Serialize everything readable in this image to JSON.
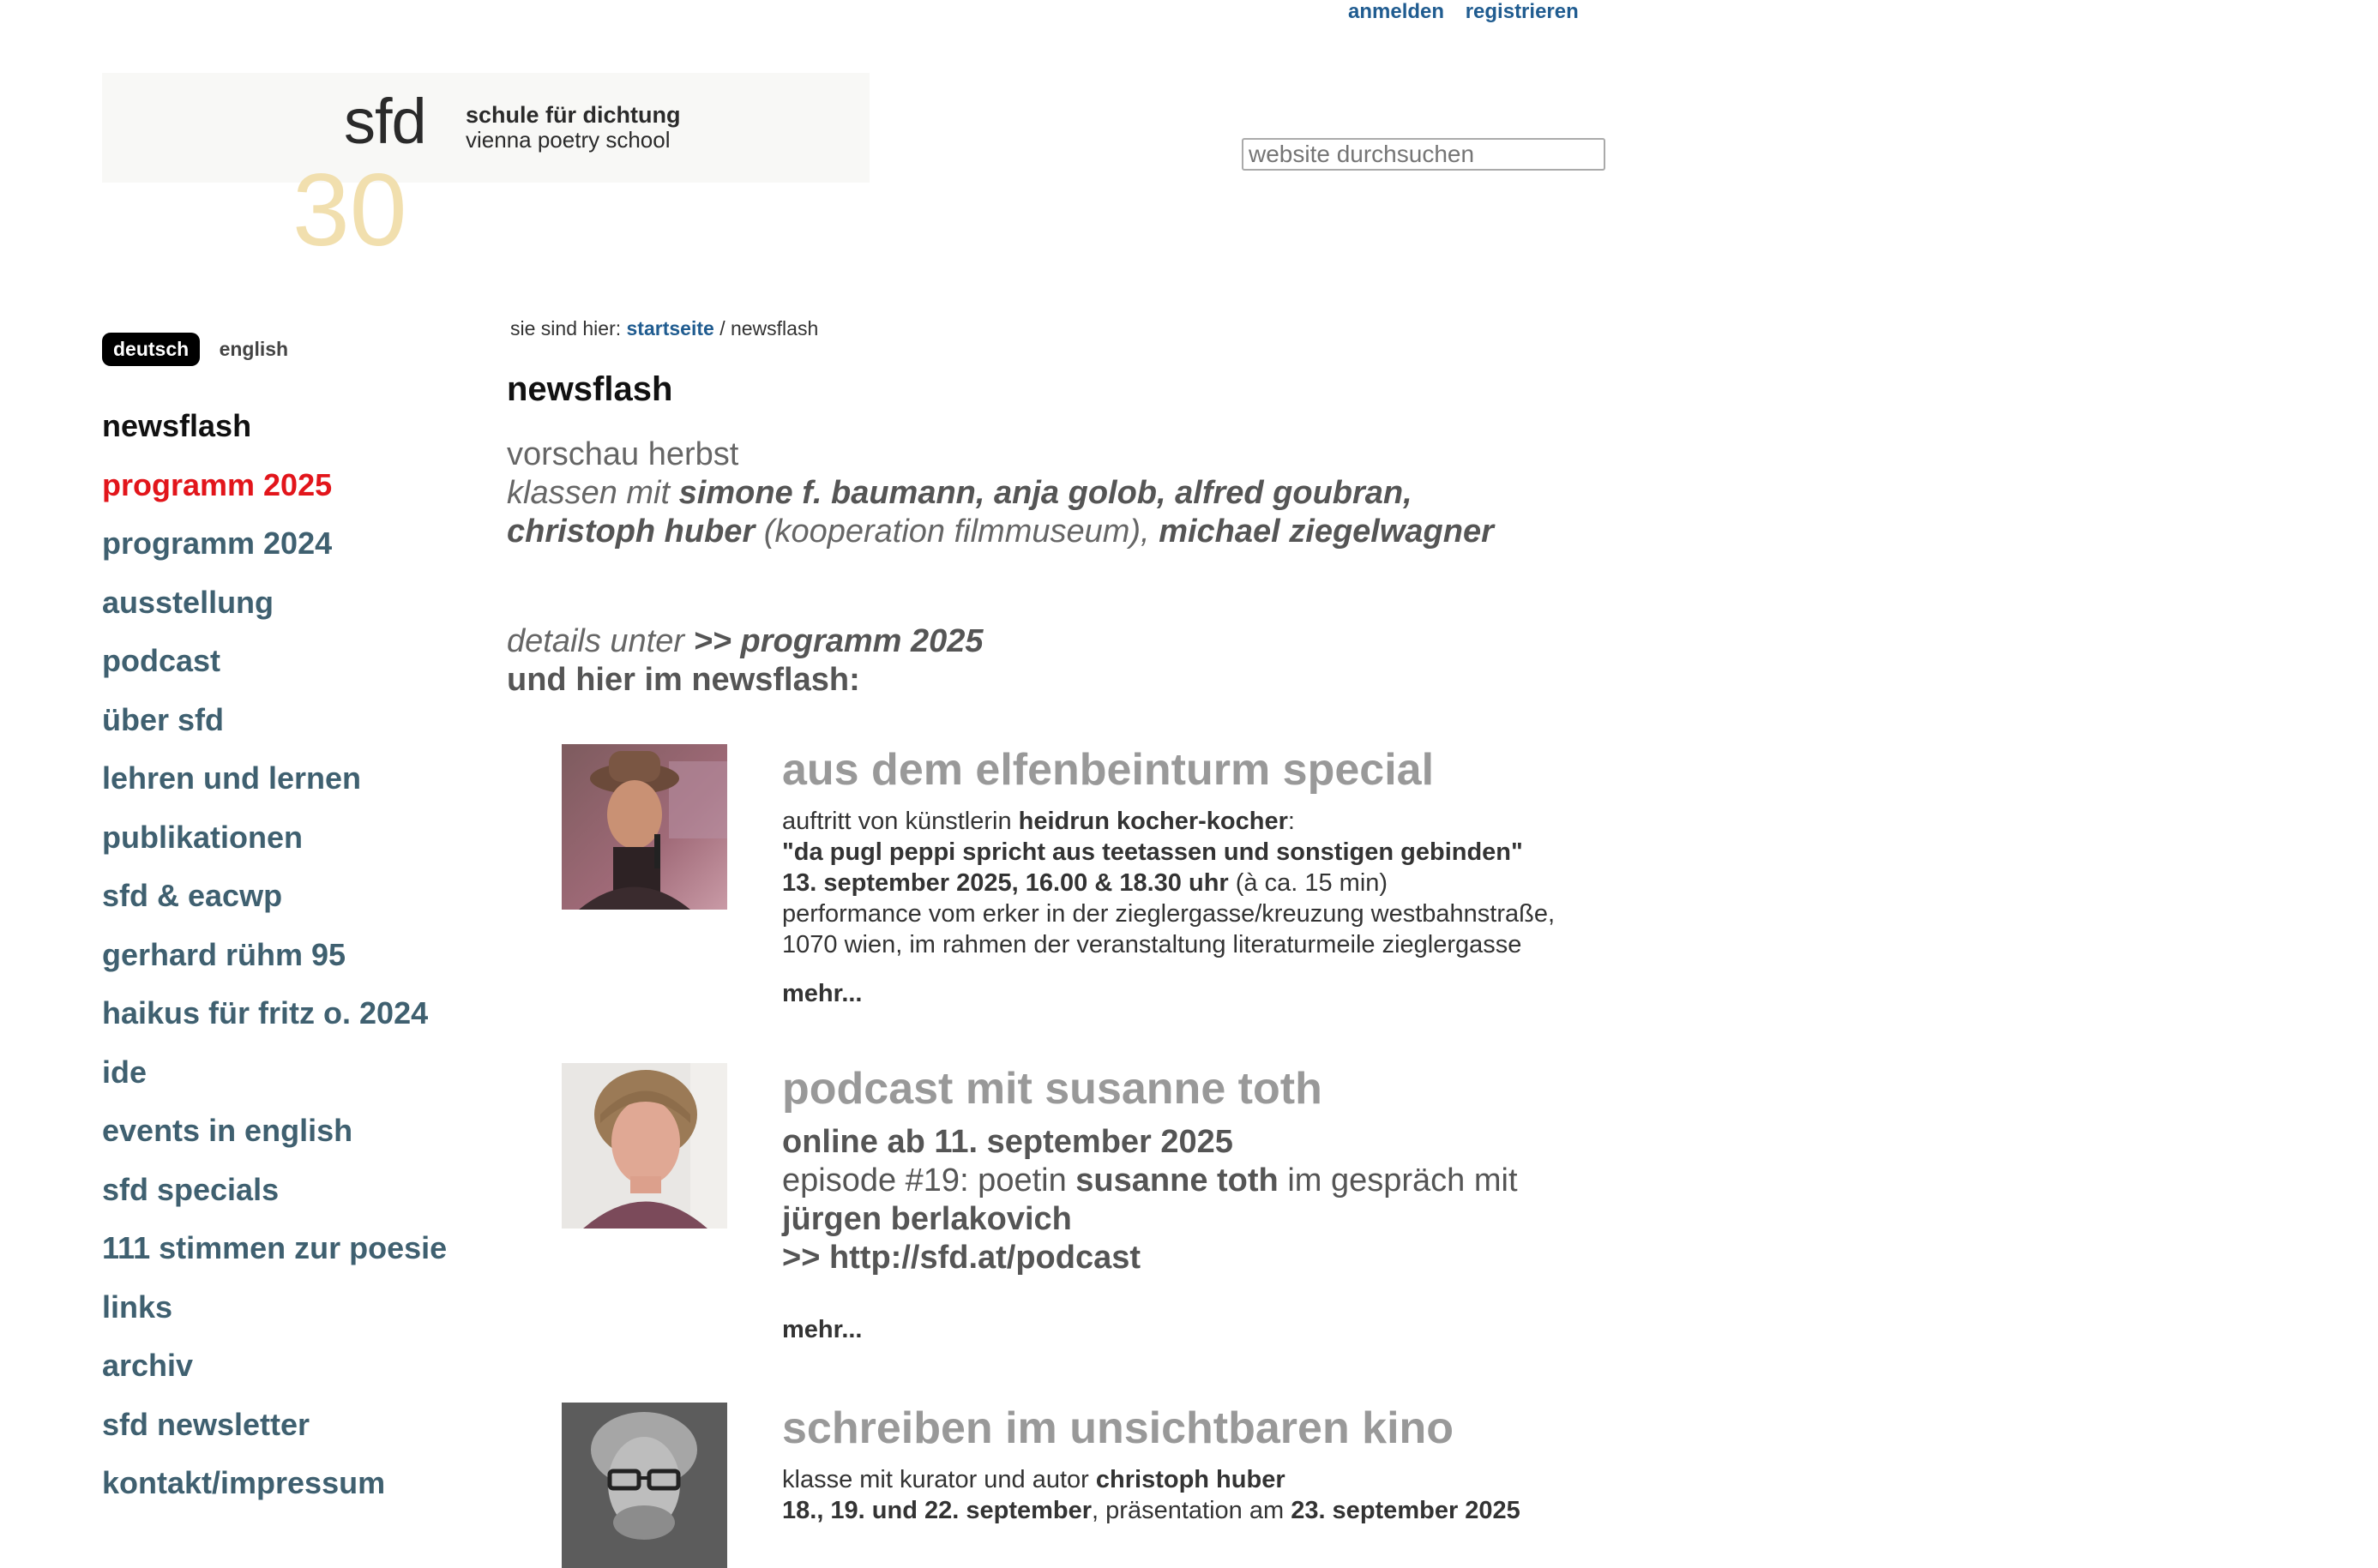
{
  "user": {
    "login": "anmelden",
    "register": "registrieren"
  },
  "logo": {
    "short": "sfd",
    "line1": "schule für dichtung",
    "line2": "vienna poetry school",
    "anniversary": "30"
  },
  "search": {
    "placeholder": "website durchsuchen"
  },
  "language": {
    "active": "deutsch",
    "other": "english"
  },
  "nav": [
    "newsflash",
    "programm 2025",
    "programm 2024",
    "ausstellung",
    "podcast",
    "über sfd",
    "lehren und lernen",
    "publikationen",
    "sfd & eacwp",
    "gerhard rühm 95",
    "haikus für fritz o. 2024",
    "ide",
    "events in english",
    "sfd specials",
    "111 stimmen zur poesie",
    "links",
    "archiv",
    "sfd newsletter",
    "kontakt/impressum"
  ],
  "breadcrumb": {
    "prefix": "sie sind hier:",
    "home": "startseite",
    "sep": "/",
    "current": "newsflash"
  },
  "page_title": "newsflash",
  "intro": {
    "line1": "vorschau herbst",
    "classes_prefix": "klassen mit",
    "names1": "simone f. baumann, anja golob, alfred goubran,",
    "name_huber": "christoph huber",
    "coop": "(kooperation filmmuseum),",
    "name_last": "michael ziegelwagner"
  },
  "details": {
    "prefix": "details unter",
    "link": ">> programm 2025",
    "line2": "und hier im newsflash:"
  },
  "items": [
    {
      "title": "aus dem elfenbeinturm special",
      "p1_a": "auftritt von künstlerin",
      "p1_b": "heidrun kocher-kocher",
      "p1_c": ":",
      "p2": "\"da pugl peppi spricht aus teetassen und sonstigen gebinden\"",
      "p3_a": "13. september 2025, 16.00 & 18.30 uhr",
      "p3_b": "(à ca. 15 min)",
      "p4": "performance vom erker in der zieglergasse/kreuzung westbahnstraße,",
      "p5": "1070 wien, im rahmen der veranstaltung literaturmeile zieglergasse",
      "more": "mehr..."
    },
    {
      "title": "podcast mit susanne toth",
      "p1": "online ab 11. september 2025",
      "p2_a": "episode #19: poetin",
      "p2_b": "susanne toth",
      "p2_c": "im gespräch mit",
      "p3": "jürgen berlakovich",
      "p4": ">> http://sfd.at/podcast",
      "more": "mehr..."
    },
    {
      "title": "schreiben im unsichtbaren kino",
      "p1_a": "klasse mit kurator und autor",
      "p1_b": "christoph huber",
      "p2_a": "18., 19. und 22. september",
      "p2_b": ", präsentation am",
      "p2_c": "23. september 2025"
    }
  ]
}
